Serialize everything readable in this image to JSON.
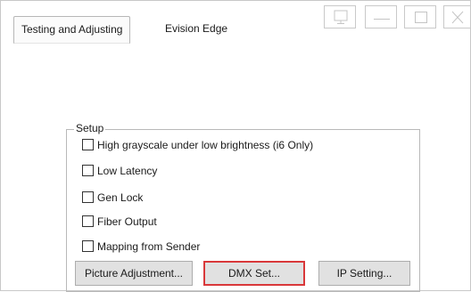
{
  "tabs": {
    "active_label": "Testing  and Adjusting",
    "inactive_label": "Evision Edge"
  },
  "window_controls": {
    "icons": [
      "monitor-icon",
      "minimize-icon",
      "maximize-icon",
      "close-icon"
    ]
  },
  "setup": {
    "title": "Setup",
    "options": [
      {
        "label": "High grayscale under  low brightness (i6 Only)",
        "checked": false
      },
      {
        "label": "Low Latency",
        "checked": false
      },
      {
        "label": "Gen Lock",
        "checked": false
      },
      {
        "label": "Fiber Output",
        "checked": false
      },
      {
        "label": "Mapping from Sender",
        "checked": false
      }
    ],
    "buttons": {
      "picture_adjustment": "Picture Adjustment...",
      "dmx_set": "DMX Set...",
      "ip_setting": "IP Setting..."
    }
  },
  "colors": {
    "highlight": "#d9383a",
    "button_face": "#e1e1e1"
  }
}
